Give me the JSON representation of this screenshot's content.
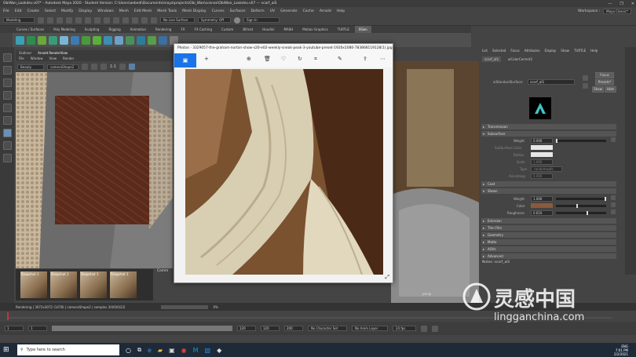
{
  "window": {
    "title": "ObiWan_Lookdev.v07* - Autodesk Maya 2020 - Student Version: C:\\Users\\aebedi\\Documents\\maya\\projects\\Obi_Wan\\scenes\\ObiWan_Lookdev.v07 --- scarf_aiS",
    "controls": [
      "—",
      "❐",
      "✕"
    ]
  },
  "menubar": {
    "items": [
      "File",
      "Edit",
      "Create",
      "Select",
      "Modify",
      "Display",
      "Windows",
      "Mesh",
      "Edit Mesh",
      "Mesh Tools",
      "Mesh Display",
      "Curves",
      "Surfaces",
      "Deform",
      "UV",
      "Generate",
      "Cache",
      "Arnold",
      "Help"
    ],
    "workspace_label": "Workspace :",
    "workspace_value": "Maya Classic*"
  },
  "statusline": {
    "mode": "Modeling",
    "live_surface": "No Live Surface",
    "symmetry": "Symmetry: Off",
    "sign_in": "Sign In"
  },
  "shelf_tabs": [
    "Curves / Surfaces",
    "Poly Modeling",
    "Sculpting",
    "Rigging",
    "Animation",
    "Rendering",
    "FX",
    "FX Caching",
    "Custom",
    "Bifrost",
    "Houdini",
    "MASH",
    "Motion Graphics",
    "TURTLE",
    "XGen"
  ],
  "shelf_active": "XGen",
  "left_panel": {
    "tabs": [
      "Outliner",
      "Arnold RenderView"
    ],
    "menu": [
      "File",
      "Window",
      "View",
      "Render"
    ],
    "display": "Beauty",
    "camera": "cameraShape2",
    "ratio": "1:1"
  },
  "thumbnails": [
    "Snapshot 1",
    "Snapshot 1",
    "Snapshot 1",
    "Snapshot 1"
  ],
  "command_label": "Comm",
  "photos": {
    "title": "Photos - 3329057-the-graham-norton-show-s20-e02-weekly-sneak-peak-3-youtube-preset-1920x1080-783868119128(1).jpg",
    "toolbar_icons": [
      "image-icon",
      "plus-icon",
      "zoom-icon",
      "delete-icon",
      "heart-icon",
      "rotate-icon",
      "crop-icon",
      "edit-icon",
      "share-icon",
      "more-icon"
    ]
  },
  "viewport": {
    "label": "persp"
  },
  "attribute_editor": {
    "top_menu": [
      "List",
      "Selected",
      "Focus",
      "Attributes",
      "Display",
      "Show",
      "TURTLE",
      "Help"
    ],
    "tabs": [
      "scarf_aiS",
      "aiColorCorrect2"
    ],
    "node_label": "aiStandardSurface:",
    "node_value": "scarf_aiS",
    "buttons": [
      "Focus",
      "Presets*",
      "Show",
      "Hide"
    ],
    "sections": [
      {
        "name": "Transmission",
        "open": false
      },
      {
        "name": "Subsurface",
        "open": true
      },
      {
        "name": "Coat",
        "open": false
      },
      {
        "name": "Sheen",
        "open": true
      },
      {
        "name": "Emission",
        "open": false
      },
      {
        "name": "Thin Film",
        "open": false
      },
      {
        "name": "Geometry",
        "open": false
      },
      {
        "name": "Matte",
        "open": false
      },
      {
        "name": "AOVs",
        "open": false
      },
      {
        "name": "Advanced",
        "open": false
      }
    ],
    "subsurface": {
      "weight_label": "Weight",
      "weight_value": "0.000",
      "subsurface_color_label": "SubSurface Color",
      "radius_label": "Radius",
      "scale_label": "Scale",
      "scale_value": "1.000",
      "type_label": "Type",
      "type_value": "randomwalk",
      "anisotropy_label": "Anisotropy",
      "anisotropy_value": "0.000"
    },
    "sheen": {
      "weight_label": "Weight",
      "weight_value": "1.000",
      "color_label": "Color",
      "color_hex": "#8a5a3c",
      "roughness_label": "Roughness",
      "roughness_value": "0.610"
    },
    "notes": "Notes: scarf_aiS"
  },
  "helpline": {
    "rendering": "Rendering | 3072x3072 (1478) | cameraShape2 | samples 3/4/0/0/2/2",
    "percent": "0%"
  },
  "timeline": {
    "start": "1",
    "current": "1",
    "range_end": "120",
    "end": "120",
    "max": "200",
    "character_set": "No Character Set",
    "anim_layer": "No Anim Layer",
    "fps": "24 fps"
  },
  "taskbar": {
    "search_placeholder": "Type here to search",
    "time": "7:01 PM",
    "date": "2/2/2021",
    "lang": "ENG"
  },
  "watermark": {
    "cn": "灵感中国",
    "url": "lingganchina.com"
  }
}
